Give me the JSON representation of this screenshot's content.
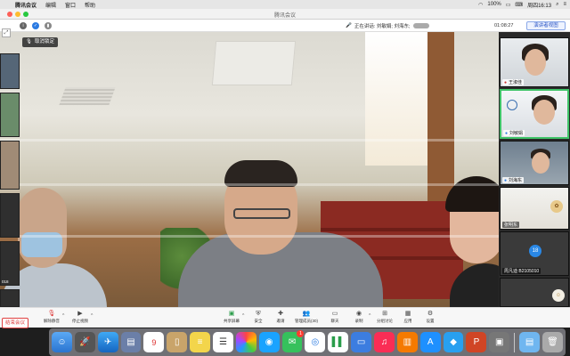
{
  "menubar": {
    "app_name": "腾讯会议",
    "menus": [
      "编辑",
      "窗口",
      "帮助"
    ],
    "battery": "100%",
    "clock": "周四16:13"
  },
  "window": {
    "title": "腾讯会议"
  },
  "top": {
    "speaking_label": "正在讲话: 刘敏娟; 刘海东;",
    "timer": "01:08:27",
    "presenter_view": "演讲者视图"
  },
  "main": {
    "mic_lock": "取消锁定"
  },
  "participants": [
    {
      "name": "王淑佳"
    },
    {
      "name": "刘敏娟"
    },
    {
      "name": "刘海东"
    },
    {
      "name": "张明东"
    },
    {
      "name": "周凡迪 B2105010"
    },
    {
      "name": ""
    }
  ],
  "left_tiles": [
    "018",
    ""
  ],
  "avatar_number": "18",
  "toolbar": {
    "unmute": "解除静音",
    "stop_video": "停止视频",
    "share_screen": "共享屏幕",
    "security": "安全",
    "invite": "邀请",
    "manage_members": "管理成员(30)",
    "chat": "聊天",
    "record": "录制",
    "breakout": "分组讨论",
    "apps": "应用",
    "settings": "设置",
    "end_meeting": "结束会议"
  },
  "dock": {
    "calendar_day": "9",
    "badges": {
      "messages": "1"
    }
  },
  "colors": {
    "active_border": "#3fc468",
    "end_red": "#e04040",
    "presenter_blue": "#2a55c4"
  }
}
